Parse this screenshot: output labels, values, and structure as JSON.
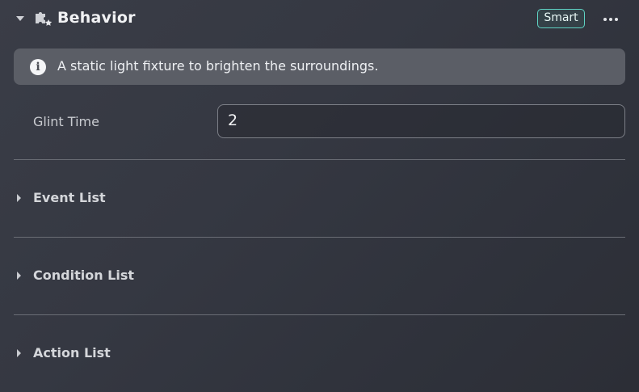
{
  "header": {
    "title": "Behavior",
    "badge": "Smart",
    "badge_color": "#5fd3c4"
  },
  "info": {
    "text": "A static light fixture to brighten the surroundings."
  },
  "field": {
    "label": "Glint Time",
    "value": "2"
  },
  "sections": [
    {
      "label": "Event List"
    },
    {
      "label": "Condition List"
    },
    {
      "label": "Action List"
    }
  ],
  "icons": {
    "collapse": "caret-down-icon",
    "header": "puzzle-icon",
    "more": "more-icon",
    "info": "info-icon",
    "expand": "caret-right-icon"
  }
}
